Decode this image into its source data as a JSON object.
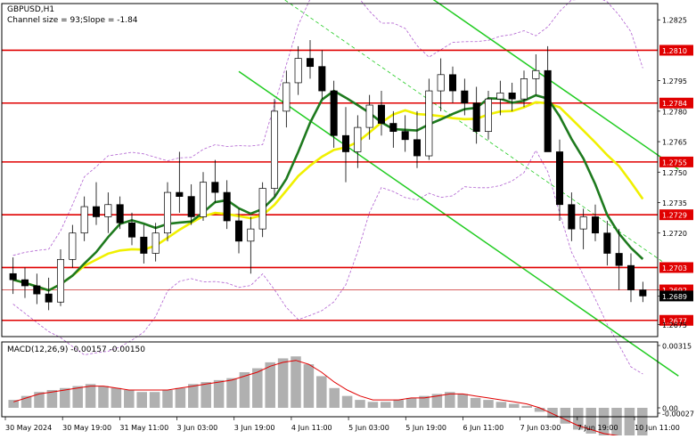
{
  "header": {
    "symbol": "GBPUSD,H1",
    "channel_info": "Channel size = 93;Slope = -1.84"
  },
  "macd": {
    "label": "MACD(12,26,9) -0.00157 -0.00150"
  },
  "colors": {
    "background": "#ffffff",
    "candle": "#000000",
    "level_line": "#e00000",
    "current_price_line": "#c00000",
    "ma_fast": "#1e7a1e",
    "ma_slow": "#f0f000",
    "channel": "#22cc22",
    "bands": "#b060d0",
    "macd_hist": "#b0b0b0",
    "macd_signal": "#e00000",
    "axis_text": "#000000"
  },
  "chart_data": {
    "type": "candlestick",
    "ylim": [
      1.2669,
      1.2833
    ],
    "y_ticks": [
      "1.2825",
      "1.2810",
      "1.2795",
      "1.2784",
      "1.2780",
      "1.2765",
      "1.2755",
      "1.2750",
      "1.2735",
      "1.2729",
      "1.2720",
      "1.2703",
      "1.2692",
      "1.2689",
      "1.2677",
      "1.2675"
    ],
    "levels": [
      "1.2810",
      "1.2784",
      "1.2755",
      "1.2729",
      "1.2703",
      "1.2677"
    ],
    "current_price": "1.2689",
    "bid_label": "1.2692",
    "x_labels": [
      "30 May 2024",
      "30 May 19:00",
      "31 May 11:00",
      "3 Jun 03:00",
      "3 Jun 19:00",
      "4 Jun 11:00",
      "5 Jun 03:00",
      "5 Jun 19:00",
      "6 Jun 11:00",
      "7 Jun 03:00",
      "7 Jun 19:00",
      "10 Jun 11:00"
    ],
    "candles": [
      [
        1.27,
        1.2708,
        1.269,
        1.2697
      ],
      [
        1.2697,
        1.2703,
        1.2688,
        1.2694
      ],
      [
        1.2694,
        1.27,
        1.2685,
        1.269
      ],
      [
        1.269,
        1.2698,
        1.2682,
        1.2686
      ],
      [
        1.2686,
        1.2712,
        1.2684,
        1.2707
      ],
      [
        1.2707,
        1.2724,
        1.2703,
        1.272
      ],
      [
        1.272,
        1.2738,
        1.2716,
        1.2733
      ],
      [
        1.2733,
        1.2745,
        1.2724,
        1.2728
      ],
      [
        1.2728,
        1.274,
        1.272,
        1.2734
      ],
      [
        1.2734,
        1.2738,
        1.2722,
        1.2725
      ],
      [
        1.2725,
        1.273,
        1.2714,
        1.2718
      ],
      [
        1.2718,
        1.2724,
        1.2705,
        1.271
      ],
      [
        1.271,
        1.2725,
        1.2706,
        1.272
      ],
      [
        1.272,
        1.2745,
        1.2716,
        1.274
      ],
      [
        1.274,
        1.276,
        1.273,
        1.2738
      ],
      [
        1.2738,
        1.2744,
        1.2724,
        1.2728
      ],
      [
        1.2728,
        1.275,
        1.2726,
        1.2745
      ],
      [
        1.2745,
        1.2756,
        1.2735,
        1.274
      ],
      [
        1.274,
        1.2746,
        1.2722,
        1.2726
      ],
      [
        1.2726,
        1.2732,
        1.271,
        1.2716
      ],
      [
        1.2716,
        1.2728,
        1.27,
        1.2722
      ],
      [
        1.2722,
        1.2745,
        1.2718,
        1.2742
      ],
      [
        1.2742,
        1.2786,
        1.2738,
        1.278
      ],
      [
        1.278,
        1.28,
        1.2772,
        1.2794
      ],
      [
        1.2794,
        1.2812,
        1.2788,
        1.2806
      ],
      [
        1.2806,
        1.2815,
        1.2796,
        1.2802
      ],
      [
        1.2802,
        1.281,
        1.2786,
        1.279
      ],
      [
        1.279,
        1.2795,
        1.2762,
        1.2768
      ],
      [
        1.2768,
        1.2782,
        1.2745,
        1.276
      ],
      [
        1.276,
        1.2778,
        1.2752,
        1.2772
      ],
      [
        1.2772,
        1.2788,
        1.2766,
        1.2783
      ],
      [
        1.2783,
        1.279,
        1.2768,
        1.2774
      ],
      [
        1.2774,
        1.278,
        1.2762,
        1.277
      ],
      [
        1.277,
        1.2778,
        1.276,
        1.2766
      ],
      [
        1.2766,
        1.278,
        1.2752,
        1.2758
      ],
      [
        1.2758,
        1.2796,
        1.2756,
        1.279
      ],
      [
        1.279,
        1.2806,
        1.278,
        1.2798
      ],
      [
        1.2798,
        1.2802,
        1.2784,
        1.279
      ],
      [
        1.279,
        1.2796,
        1.2778,
        1.2784
      ],
      [
        1.2784,
        1.2792,
        1.2764,
        1.277
      ],
      [
        1.277,
        1.279,
        1.2766,
        1.2786
      ],
      [
        1.2786,
        1.2795,
        1.2778,
        1.2789
      ],
      [
        1.2789,
        1.2794,
        1.278,
        1.2786
      ],
      [
        1.2786,
        1.28,
        1.2782,
        1.2796
      ],
      [
        1.2796,
        1.2808,
        1.2788,
        1.28
      ],
      [
        1.28,
        1.2812,
        1.2782,
        1.276
      ],
      [
        1.276,
        1.2766,
        1.2726,
        1.2734
      ],
      [
        1.2734,
        1.274,
        1.2716,
        1.2722
      ],
      [
        1.2722,
        1.2732,
        1.2712,
        1.2728
      ],
      [
        1.2728,
        1.2734,
        1.2716,
        1.272
      ],
      [
        1.272,
        1.2726,
        1.2704,
        1.271
      ],
      [
        1.271,
        1.2722,
        1.2692,
        1.2704
      ],
      [
        1.2704,
        1.271,
        1.2686,
        1.2692
      ],
      [
        1.2692,
        1.2696,
        1.2686,
        1.2689
      ]
    ],
    "macd_histogram": [
      0.0004,
      0.0006,
      0.0008,
      0.0009,
      0.001,
      0.0011,
      0.0012,
      0.0011,
      0.001,
      0.0009,
      0.0008,
      0.0008,
      0.0009,
      0.001,
      0.0012,
      0.0013,
      0.0014,
      0.0015,
      0.0018,
      0.002,
      0.0023,
      0.0025,
      0.0026,
      0.0022,
      0.0016,
      0.001,
      0.0006,
      0.0004,
      0.0003,
      0.0003,
      0.0004,
      0.0005,
      0.0006,
      0.0007,
      0.0008,
      0.0007,
      0.0005,
      0.0004,
      0.0003,
      0.0002,
      0.0001,
      -0.0002,
      -0.0005,
      -0.0008,
      -0.0011,
      -0.0013,
      -0.0015,
      -0.0016,
      -0.0016,
      -0.00157
    ],
    "macd_signal": [
      0.0003,
      0.0005,
      0.0007,
      0.0008,
      0.0009,
      0.001,
      0.0011,
      0.0011,
      0.001,
      0.0009,
      0.0009,
      0.0009,
      0.0009,
      0.001,
      0.0011,
      0.0012,
      0.0013,
      0.0014,
      0.0016,
      0.0018,
      0.0021,
      0.0023,
      0.0024,
      0.0022,
      0.0018,
      0.0013,
      0.0009,
      0.0006,
      0.0004,
      0.0004,
      0.0004,
      0.0005,
      0.0005,
      0.0006,
      0.0007,
      0.0007,
      0.0006,
      0.0005,
      0.0004,
      0.0003,
      0.0002,
      0.0,
      -0.0003,
      -0.0006,
      -0.0009,
      -0.0011,
      -0.0013,
      -0.0014,
      -0.0015,
      -0.0015
    ],
    "macd_ylim": [
      -0.00027,
      0.00315
    ],
    "macd_ticks": [
      "0.00315",
      "0.00",
      "-0.00027"
    ]
  }
}
